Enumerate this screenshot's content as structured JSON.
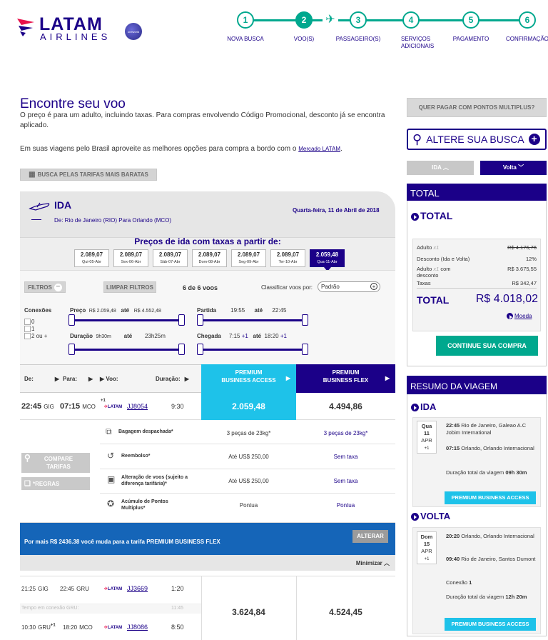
{
  "header": {
    "logo_name": "LATAM",
    "logo_sub": "AIRLINES",
    "badge": "oneworld",
    "steps": [
      {
        "num": "1",
        "label": "NOVA BUSCA"
      },
      {
        "num": "2",
        "label": "VOO(S)"
      },
      {
        "num": "3",
        "label": "PASSAGEIRO(S)"
      },
      {
        "num": "4",
        "label": "SERVIÇOS ADICIONAIS"
      },
      {
        "num": "5",
        "label": "PAGAMENTO"
      },
      {
        "num": "6",
        "label": "CONFIRMAÇÃO"
      }
    ],
    "active_step": 2
  },
  "intro": {
    "title": "Encontre seu voo",
    "text": "O preço é para um adulto, incluindo taxas. Para compras envolvendo Código Promocional, desconto já se encontra aplicado.",
    "text2": "Em suas viagens pelo Brasil aproveite as melhores opções para compra a bordo com o ",
    "link": "Mercado LATAM",
    "cheap_btn": "BUSCA PELAS TARIFAS MAIS BARATAS"
  },
  "ida": {
    "label": "IDA",
    "route": "De: Rio de Janeiro (RIO) Para Orlando (MCO)",
    "date": "Quarta-feira, 11 de Abril de 2018",
    "price_title": "Preços de ida com taxas a partir de:",
    "days": [
      {
        "price": "2.089,07",
        "day": "Qui-05-Abr"
      },
      {
        "price": "2.089,07",
        "day": "Sex-06-Abr"
      },
      {
        "price": "2.089,07",
        "day": "Sáb-07-Abr"
      },
      {
        "price": "2.089,07",
        "day": "Dom-08-Abr"
      },
      {
        "price": "2.089,07",
        "day": "Seg-09-Abr"
      },
      {
        "price": "2.089,07",
        "day": "Ter-10-Abr"
      },
      {
        "price": "2.059,48",
        "day": "Qua-11-Abr"
      }
    ]
  },
  "filters": {
    "filtros": "FILTROS",
    "limpar": "LIMPAR FILTROS",
    "count": "6 de 6 voos",
    "sort_label": "Classificar voos por:",
    "sort_value": "Padrão",
    "conexoes": "Conexões",
    "conn_opts": [
      "0",
      "1",
      "2 ou +"
    ],
    "preco": "Preço",
    "preco_min": "R$ 2.059,48",
    "ate": "até",
    "preco_max": "R$ 4.552,48",
    "partida": "Partida",
    "partida_min": "19:55",
    "partida_max": "22:45",
    "duracao": "Duração",
    "dur_min": "9h30m",
    "dur_max": "23h25m",
    "chegada": "Chegada",
    "cheg_min": "7:15",
    "cheg_min_plus": "+1",
    "cheg_max": "18:20",
    "cheg_max_plus": "+1"
  },
  "table": {
    "de": "De:",
    "para": "Para:",
    "voo": "Voo:",
    "duracao": "Duração:",
    "pba": "PREMIUM BUSINESS ACCESS",
    "pbf": "PREMIUM BUSINESS FLEX"
  },
  "flight1": {
    "dep_time": "22:45",
    "dep_ap": "GIG",
    "arr_time": "07:15",
    "arr_ap": "MCO",
    "plus": "+1",
    "airline": "LATAM",
    "flight": "JJ8054",
    "duration": "9:30",
    "pba_price": "2.059,48",
    "pbf_price": "4.494,86",
    "details": [
      {
        "label": "Bagagem despachada*",
        "pba": "3 peças de 23kg*",
        "pbf": "3 peças de 23kg*"
      },
      {
        "label": "Reembolso*",
        "pba": "Até US$ 250,00",
        "pbf": "Sem taxa"
      },
      {
        "label": "Alteração de voos (sujeito a diferença tarifária)*",
        "pba": "Até US$ 250,00",
        "pbf": "Sem taxa"
      },
      {
        "label": "Acúmulo de Pontos Multiplus*",
        "pba": "Pontua",
        "pbf": "Pontua"
      }
    ],
    "compare": "COMPARE TARIFAS",
    "rules": "*REGRAS",
    "upsell": "Por mais R$ 2436.38 você muda para a tarifa PREMIUM BUSINESS FLEX",
    "alterar": "ALTERAR",
    "minimize": "Minimizar"
  },
  "flight2": {
    "seg1_dep": "21:25",
    "seg1_dep_ap": "GIG",
    "seg1_arr": "22:45",
    "seg1_arr_ap": "GRU",
    "seg1_flight": "JJ3669",
    "seg1_dur": "1:20",
    "conn_text": "Tempo em conexão GRU:",
    "conn_time": "11:45",
    "seg2_dep": "10:30",
    "seg2_dep_ap": "GRU",
    "seg2_plus": "+1",
    "seg2_arr": "18:20",
    "seg2_arr_ap": "MCO",
    "seg2_flight": "JJ8086",
    "seg2_dur": "8:50",
    "pba_price": "3.624,84",
    "pbf_price": "4.524,45"
  },
  "sidebar": {
    "multiplus": "QUER PAGAR COM PONTOS MULTIPLUS?",
    "alter": "ALTERE SUA BUSCA",
    "tab_ida": "IDA",
    "tab_volta": "Volta",
    "total_hdr": "TOTAL",
    "total_sub": "TOTAL",
    "lines": [
      {
        "label": "Adulto",
        "sup": "x1",
        "value": "R$ 4.176,76",
        "strike": true
      },
      {
        "label": "Desconto (Ida e Volta)",
        "value": "12%"
      },
      {
        "label": "Adulto",
        "sup": "x1",
        "label2": " com desconto",
        "value": "R$ 3.675,55"
      },
      {
        "label": "Taxas",
        "value": "R$ 342,47"
      }
    ],
    "total_label": "TOTAL",
    "total_value": "R$ 4.018,02",
    "moeda": "Moeda",
    "continue": "CONTINUE SUA COMPRA",
    "resumo": "RESUMO DA VIAGEM",
    "ida_label": "IDA",
    "ida_card": {
      "dow": "Qua",
      "day": "11",
      "month": "APR",
      "plus": "+1",
      "dep": "22:45",
      "dep_place": " Rio de Janeiro, Galeao A.C Jobim International",
      "arr": "07:15",
      "arr_place": " Orlando, Orlando Internacional",
      "dur_label": "Duração total da viagem ",
      "dur": "09h 30m",
      "tag": "PREMIUM BUSINESS ACCESS"
    },
    "volta_label": "VOLTA",
    "volta_card": {
      "dow": "Dom",
      "day": "15",
      "month": "APR",
      "plus": "+1",
      "dep": "20:20",
      "dep_place": " Orlando, Orlando Internacional",
      "arr": "09:40",
      "arr_place": " Rio de Janeiro, Santos Dumont",
      "conn_label": "Conexão ",
      "conn": "1",
      "dur_label": "Duração total da viagem ",
      "dur": "12h 20m",
      "tag": "PREMIUM BUSINESS ACCESS"
    }
  }
}
